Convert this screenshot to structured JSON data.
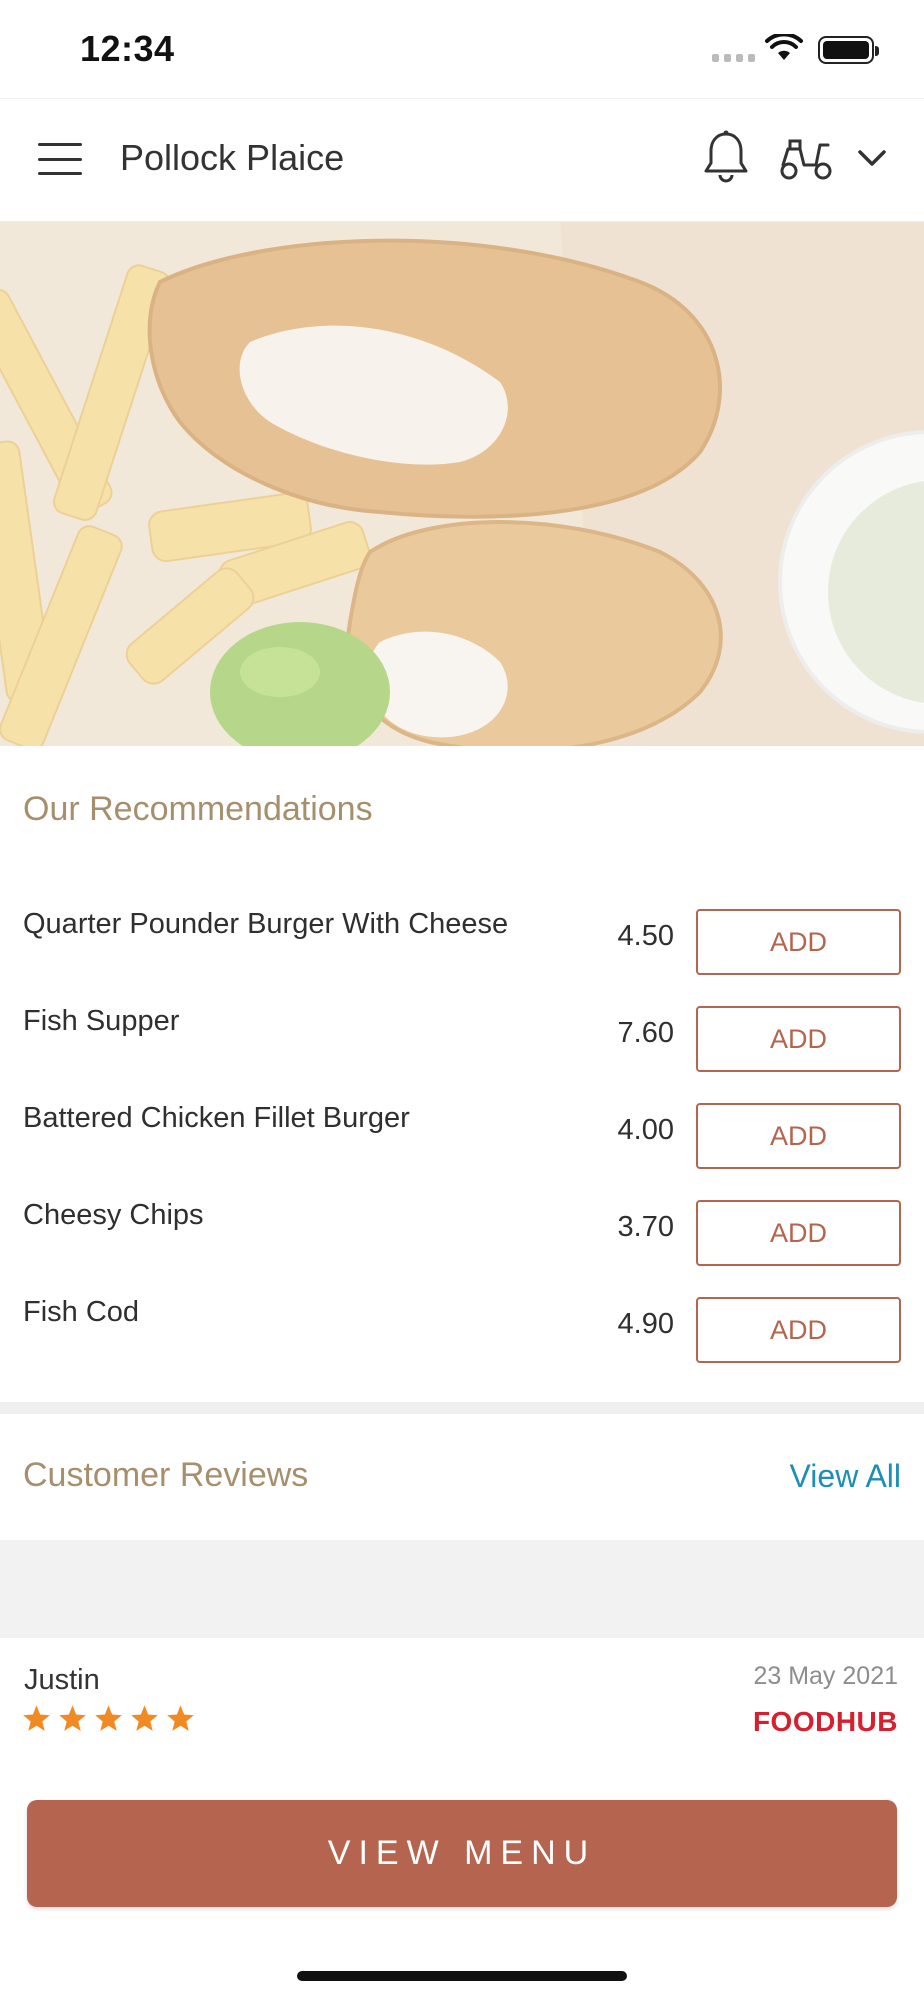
{
  "status_bar": {
    "time": "12:34"
  },
  "header": {
    "restaurant_name": "Pollock Plaice",
    "icons": [
      "menu-icon",
      "bell-icon",
      "scooter-icon",
      "chevron-down-icon"
    ]
  },
  "recommendations": {
    "title": "Our Recommendations",
    "items": [
      {
        "name": "Quarter Pounder Burger With Cheese",
        "price": "4.50",
        "action": "ADD"
      },
      {
        "name": "Fish Supper",
        "price": "7.60",
        "action": "ADD"
      },
      {
        "name": "Battered Chicken Fillet Burger",
        "price": "4.00",
        "action": "ADD"
      },
      {
        "name": "Cheesy Chips",
        "price": "3.70",
        "action": "ADD"
      },
      {
        "name": "Fish Cod",
        "price": "4.90",
        "action": "ADD"
      }
    ]
  },
  "reviews": {
    "title": "Customer Reviews",
    "view_all": "View All",
    "items": [
      {
        "name": "Justin",
        "date": "23 May 2021",
        "rating": 5,
        "source": "FOODHUB"
      }
    ]
  },
  "cta": {
    "label": "VIEW MENU"
  },
  "colors": {
    "accent": "#b5644f",
    "section_title": "#a68f6d",
    "link": "#1d8fb7",
    "star": "#f08a24",
    "foodhub": "#d6202f"
  }
}
